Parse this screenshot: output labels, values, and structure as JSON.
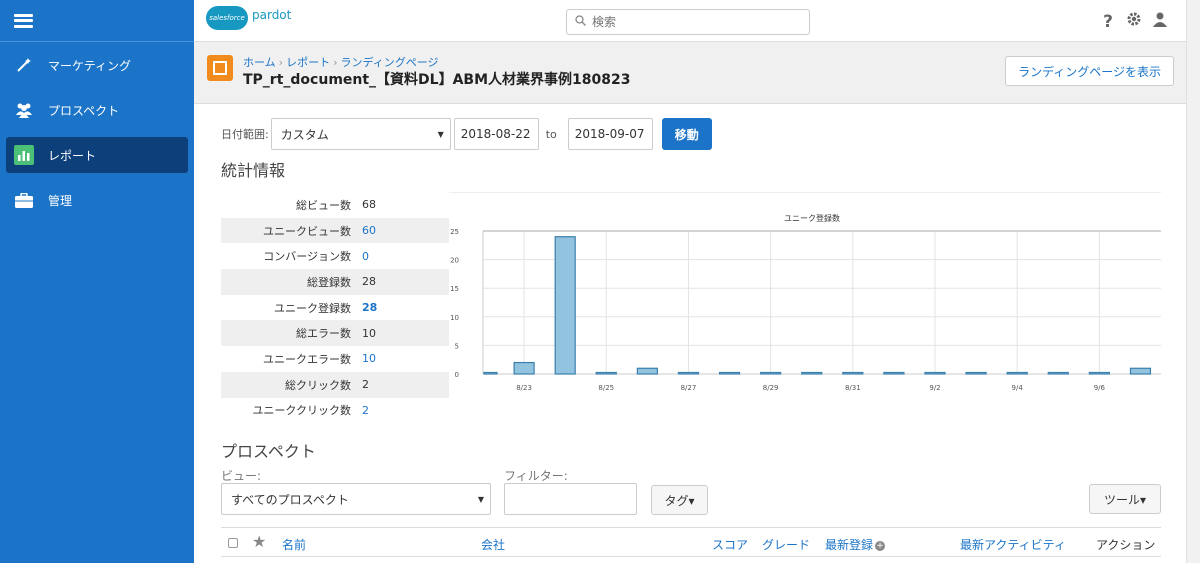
{
  "sidebar": {
    "items": [
      {
        "label": "マーケティング",
        "icon": "magic-wand-icon",
        "active": false
      },
      {
        "label": "プロスペクト",
        "icon": "users-icon",
        "active": false
      },
      {
        "label": "レポート",
        "icon": "report-chart-icon",
        "active": true
      },
      {
        "label": "管理",
        "icon": "briefcase-icon",
        "active": false
      }
    ]
  },
  "topbar": {
    "logo_cloud_text": "salesforce",
    "logo_product": "pardot",
    "search_placeholder": "検索",
    "icons": [
      "help-icon",
      "gear-icon",
      "user-icon"
    ]
  },
  "header": {
    "breadcrumb": [
      "ホーム",
      "レポート",
      "ランディングページ"
    ],
    "title": "TP_rt_document_【資料DL】ABM人材業界事例180823",
    "view_button": "ランディングページを表示"
  },
  "date_range": {
    "label": "日付範囲:",
    "preset": "カスタム",
    "start": "2018-08-22",
    "to_label": "to",
    "end": "2018-09-07",
    "go_button": "移動"
  },
  "stats": {
    "title": "統計情報",
    "rows": [
      {
        "label": "総ビュー数",
        "value": "68",
        "link": false,
        "bold": false
      },
      {
        "label": "ユニークビュー数",
        "value": "60",
        "link": true,
        "bold": false
      },
      {
        "label": "コンバージョン数",
        "value": "0",
        "link": true,
        "bold": false
      },
      {
        "label": "総登録数",
        "value": "28",
        "link": false,
        "bold": false
      },
      {
        "label": "ユニーク登録数",
        "value": "28",
        "link": true,
        "bold": true
      },
      {
        "label": "総エラー数",
        "value": "10",
        "link": false,
        "bold": false
      },
      {
        "label": "ユニークエラー数",
        "value": "10",
        "link": true,
        "bold": false
      },
      {
        "label": "総クリック数",
        "value": "2",
        "link": false,
        "bold": false
      },
      {
        "label": "ユニーククリック数",
        "value": "2",
        "link": true,
        "bold": false
      }
    ]
  },
  "chart_data": {
    "type": "bar",
    "title": "ユニーク登録数",
    "x": [
      "8/22",
      "8/23",
      "8/24",
      "8/25",
      "8/26",
      "8/27",
      "8/28",
      "8/29",
      "8/30",
      "8/31",
      "9/1",
      "9/2",
      "9/3",
      "9/4",
      "9/5",
      "9/6",
      "9/7"
    ],
    "x_tick_labels": [
      "8/23",
      "8/25",
      "8/27",
      "8/29",
      "8/31",
      "9/2",
      "9/4",
      "9/6"
    ],
    "values": [
      0,
      2,
      24,
      0,
      1,
      0,
      0,
      0,
      0,
      0,
      0,
      0,
      0,
      0,
      0,
      0,
      1
    ],
    "yticks": [
      0,
      5,
      10,
      15,
      20,
      25
    ],
    "ylim": [
      0,
      25
    ],
    "grid": true,
    "bar_color": "#92c3df",
    "bar_border": "#3a7fad"
  },
  "prospects": {
    "title": "プロスペクト",
    "view_label": "ビュー:",
    "view_value": "すべてのプロスペクト",
    "filter_label": "フィルター:",
    "tag_button": "タグ▾",
    "tool_button": "ツール▾",
    "columns": [
      "名前",
      "会社",
      "スコア",
      "グレード",
      "最新登録",
      "最新アクティビティ",
      "アクション"
    ]
  }
}
